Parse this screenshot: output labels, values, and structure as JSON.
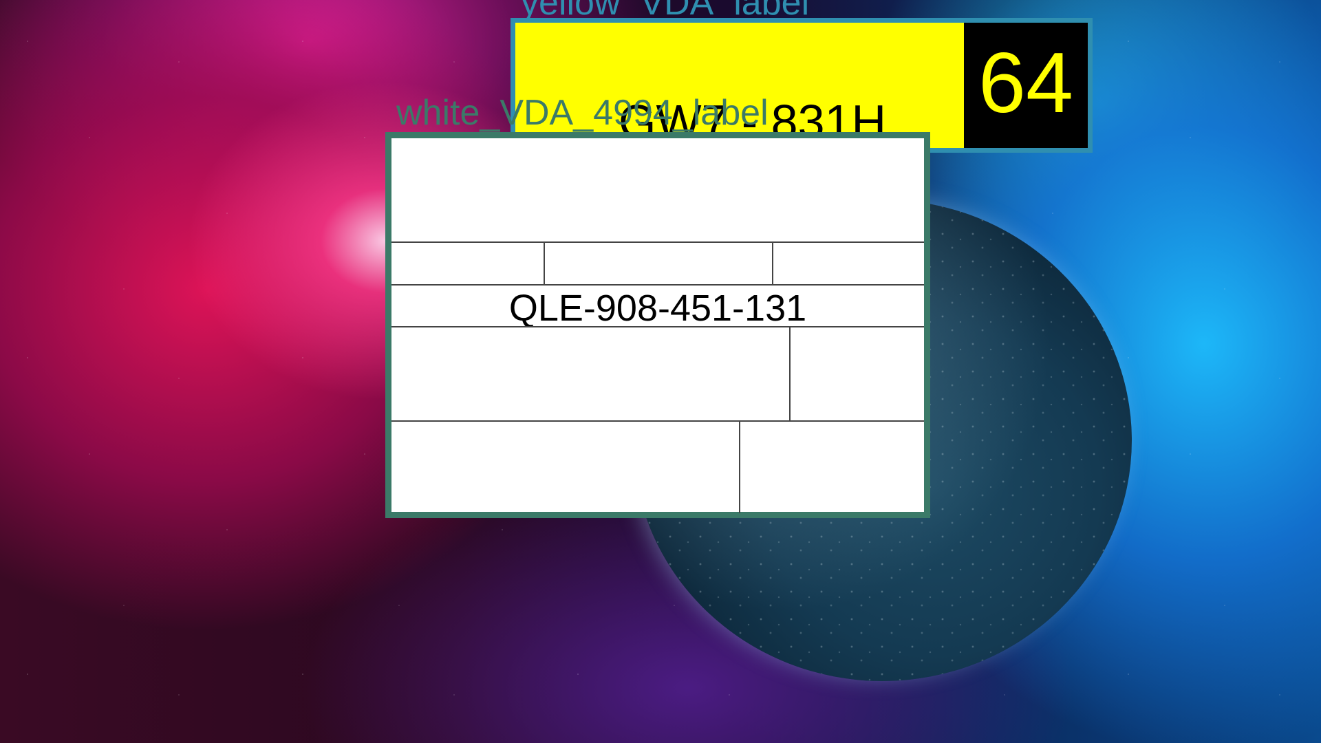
{
  "labels": {
    "yellow": {
      "caption": "yellow_VDA_label",
      "code": "GW7 - 831H",
      "number": "64",
      "colors": {
        "background": "#ffff00",
        "border": "#2f8fb0",
        "number_box": "#000000",
        "number_text": "#ffff00"
      }
    },
    "white": {
      "caption": "white_VDA_4994_label",
      "code": "QLE-908-451-131",
      "colors": {
        "background": "#ffffff",
        "border": "#3b7a68"
      }
    }
  }
}
